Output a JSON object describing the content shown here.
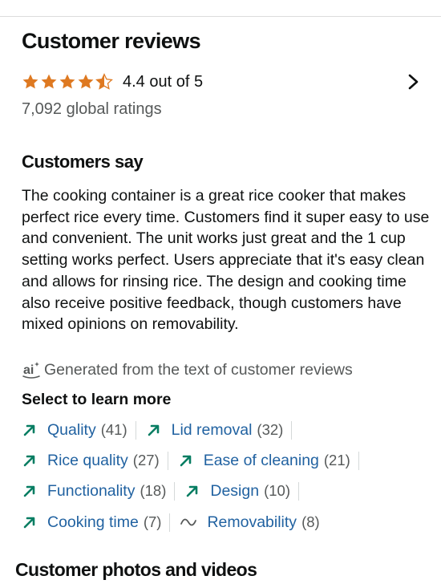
{
  "header": {
    "title": "Customer reviews"
  },
  "rating": {
    "stars": 4.4,
    "text": "4.4 out of 5",
    "global_ratings": "7,092 global ratings",
    "star_color": "#de7921"
  },
  "customers_say": {
    "title": "Customers say",
    "summary": "The cooking container is a great rice cooker that makes perfect rice every time. Customers find it super easy to use and convenient. The unit works just great and the 1 cup setting works perfect. Users appreciate that it's easy clean and allows for rinsing rice. The design and cooking time also receive positive feedback, though customers have mixed opinions on removability.",
    "ai_note": "Generated from the text of customer reviews",
    "ai_icon": "ai-icon"
  },
  "learn_more": {
    "title": "Select to learn more",
    "rows": [
      [
        {
          "label": "Quality",
          "count": "(41)",
          "sentiment": "positive"
        },
        {
          "label": "Lid removal",
          "count": "(32)",
          "sentiment": "positive"
        }
      ],
      [
        {
          "label": "Rice quality",
          "count": "(27)",
          "sentiment": "positive"
        },
        {
          "label": "Ease of cleaning",
          "count": "(21)",
          "sentiment": "positive"
        }
      ],
      [
        {
          "label": "Functionality",
          "count": "(18)",
          "sentiment": "positive"
        },
        {
          "label": "Design",
          "count": "(10)",
          "sentiment": "positive"
        }
      ],
      [
        {
          "label": "Cooking time",
          "count": "(7)",
          "sentiment": "positive"
        },
        {
          "label": "Removability",
          "count": "(8)",
          "sentiment": "mixed"
        }
      ]
    ]
  },
  "photos": {
    "title": "Customer photos and videos"
  },
  "colors": {
    "link": "#2162a1",
    "positive_arrow": "#067d62",
    "mixed_icon": "#565959"
  }
}
